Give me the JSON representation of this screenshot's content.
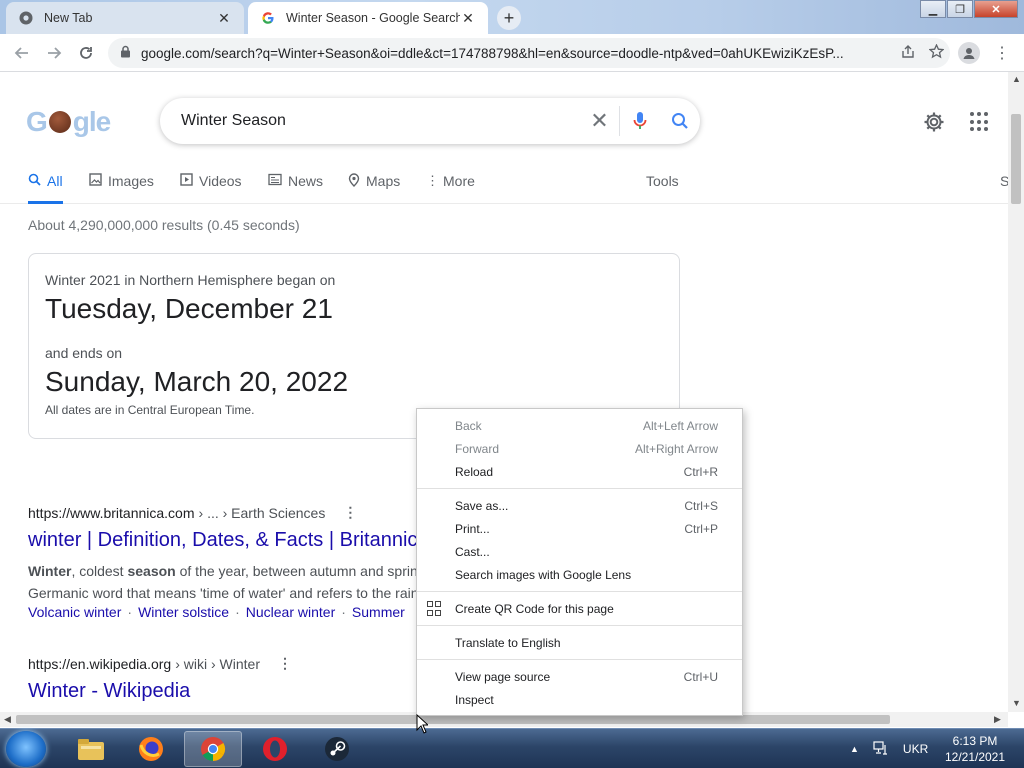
{
  "browser": {
    "tabs": [
      {
        "title": "New Tab",
        "close": "✕"
      },
      {
        "title": "Winter Season - Google Search",
        "close": "✕"
      }
    ],
    "new_tab": "+",
    "url": "google.com/search?q=Winter+Season&oi=ddle&ct=174788798&hl=en&source=doodle-ntp&ved=0ahUKEwiziKzEsP..."
  },
  "search": {
    "query": "Winter Season",
    "tabs": [
      {
        "label": "All",
        "icon": "search-icon"
      },
      {
        "label": "Images",
        "icon": "image-icon"
      },
      {
        "label": "Videos",
        "icon": "video-icon"
      },
      {
        "label": "News",
        "icon": "news-icon"
      },
      {
        "label": "Maps",
        "icon": "map-pin-icon"
      },
      {
        "label": "More",
        "icon": "more-vert-icon"
      }
    ],
    "tools": "Tools",
    "edge_letter": "S",
    "stats": "About 4,290,000,000 results (0.45 seconds)"
  },
  "answer_card": {
    "line1": "Winter 2021 in Northern Hemisphere began on",
    "start": "Tuesday, December 21",
    "line2": "and ends on",
    "end": "Sunday, March 20, 2022",
    "note": "All dates are in Central European Time."
  },
  "results": [
    {
      "site": "https://www.britannica.com",
      "crumb": "› ... › Earth Sciences",
      "title": "winter | Definition, Dates, & Facts | Britannica",
      "snippet_b1": "Winter",
      "snippet_t1": ", coldest ",
      "snippet_b2": "season",
      "snippet_t2": " of the year, between autumn and spring; the name comes from an old",
      "snippet_line2": "Germanic word that means 'time of water' and refers to the rain and snow of winter in",
      "links": [
        "Volcanic winter",
        "Winter solstice",
        "Nuclear winter",
        "Summer"
      ]
    },
    {
      "site": "https://en.wikipedia.org",
      "crumb": "› wiki › Winter",
      "title": "Winter - Wikipedia"
    }
  ],
  "context_menu": {
    "items": [
      {
        "label": "Back",
        "shortcut": "Alt+Left Arrow"
      },
      {
        "label": "Forward",
        "shortcut": "Alt+Right Arrow"
      },
      {
        "label": "Reload",
        "shortcut": "Ctrl+R"
      },
      {
        "label": "Save as...",
        "shortcut": "Ctrl+S"
      },
      {
        "label": "Print...",
        "shortcut": "Ctrl+P"
      },
      {
        "label": "Cast...",
        "shortcut": ""
      },
      {
        "label": "Search images with Google Lens",
        "shortcut": ""
      },
      {
        "label": "Create QR Code for this page",
        "shortcut": ""
      },
      {
        "label": "Translate to English",
        "shortcut": ""
      },
      {
        "label": "View page source",
        "shortcut": "Ctrl+U"
      },
      {
        "label": "Inspect",
        "shortcut": ""
      }
    ]
  },
  "taskbar": {
    "language": "UKR",
    "time": "6:13 PM",
    "date": "12/21/2021",
    "apps": [
      "explorer-icon",
      "firefox-icon",
      "chrome-icon",
      "opera-icon",
      "steam-icon"
    ]
  },
  "colors": {
    "link": "#1a0dab",
    "accent": "#1a73e8",
    "google_blue": "#4285f4",
    "google_red": "#ea4335"
  }
}
